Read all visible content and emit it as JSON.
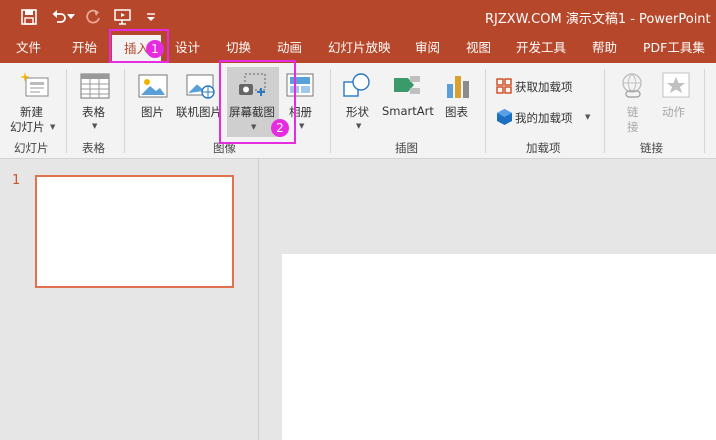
{
  "titlebar": {
    "title": "RJZXW.COM  演示文稿1  -  PowerPoint",
    "icons": [
      "save-icon",
      "undo-icon",
      "undo-dropdown-icon",
      "redo-icon",
      "start-from-beginning-icon",
      "customize-qat-icon"
    ]
  },
  "tabs": [
    {
      "label": "文件"
    },
    {
      "label": "开始"
    },
    {
      "label": "插入"
    },
    {
      "label": "设计"
    },
    {
      "label": "切换"
    },
    {
      "label": "动画"
    },
    {
      "label": "幻灯片放映"
    },
    {
      "label": "审阅"
    },
    {
      "label": "视图"
    },
    {
      "label": "开发工具"
    },
    {
      "label": "帮助"
    },
    {
      "label": "PDF工具集"
    }
  ],
  "ribbon": {
    "new_slide": "新建\n幻灯片",
    "new_slide_line1": "新建",
    "new_slide_line2": "幻灯片",
    "table": "表格",
    "picture": "图片",
    "online_picture": "联机图片",
    "screenshot": "屏幕截图",
    "album": "相册",
    "shapes": "形状",
    "smartart": "SmartArt",
    "chart": "图表",
    "get_addins": "获取加载项",
    "my_addins": "我的加载项",
    "link": "链\n接",
    "link_line1": "链",
    "link_line2": "接",
    "action": "动作",
    "groups": {
      "slides": "幻灯片",
      "tables": "表格",
      "images": "图像",
      "illustrations": "插图",
      "addins": "加载项",
      "links": "链接"
    }
  },
  "slides_pane": {
    "slide_number": "1"
  },
  "annotations": {
    "badge1": "1",
    "badge2": "2"
  },
  "colors": {
    "accent": "#b7472a",
    "highlight": "#e52ce0",
    "thumb_border": "#e1714f"
  }
}
